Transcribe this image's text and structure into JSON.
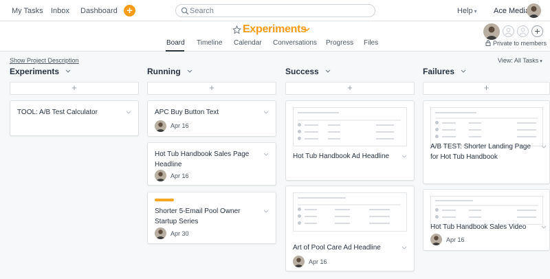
{
  "nav": {
    "my_tasks": "My Tasks",
    "inbox": "Inbox",
    "dashboard": "Dashboard"
  },
  "search": {
    "placeholder": "Search"
  },
  "header_right": {
    "help": "Help",
    "org": "Ace Media"
  },
  "project": {
    "title": "Experiments",
    "tabs": [
      {
        "label": "Board"
      },
      {
        "label": "Timeline"
      },
      {
        "label": "Calendar"
      },
      {
        "label": "Conversations"
      },
      {
        "label": "Progress"
      },
      {
        "label": "Files"
      }
    ],
    "private_label": "Private to members"
  },
  "board": {
    "show_description": "Show Project Description",
    "view_all": "View: All Tasks",
    "columns": [
      {
        "title": "Experiments",
        "cards": [
          {
            "name": "TOOL: A/B Test Calculator"
          }
        ]
      },
      {
        "title": "Running",
        "cards": [
          {
            "name": "APC Buy Button Text",
            "date": "Apr 16"
          },
          {
            "name": "Hot Tub Handbook Sales Page Headline",
            "date": "Apr 16"
          },
          {
            "name": "Shorter 5-Email Pool Owner Startup Series",
            "date": "Apr 30"
          }
        ]
      },
      {
        "title": "Success",
        "cards": [
          {
            "name": "Hot Tub Handbook Ad Headline"
          },
          {
            "name": "Art of Pool Care Ad Headline",
            "date": "Apr 16"
          }
        ]
      },
      {
        "title": "Failures",
        "cards": [
          {
            "name": "A/B TEST: Shorter Landing Page for Hot Tub Handbook"
          },
          {
            "name": "Hot Tub Handbook Sales Video",
            "date": "Apr 16"
          }
        ]
      }
    ]
  },
  "colors": {
    "accent": "#f59b16",
    "tag_orange": "#f5a623",
    "text": "#273240",
    "background": "#f6f8f9"
  }
}
